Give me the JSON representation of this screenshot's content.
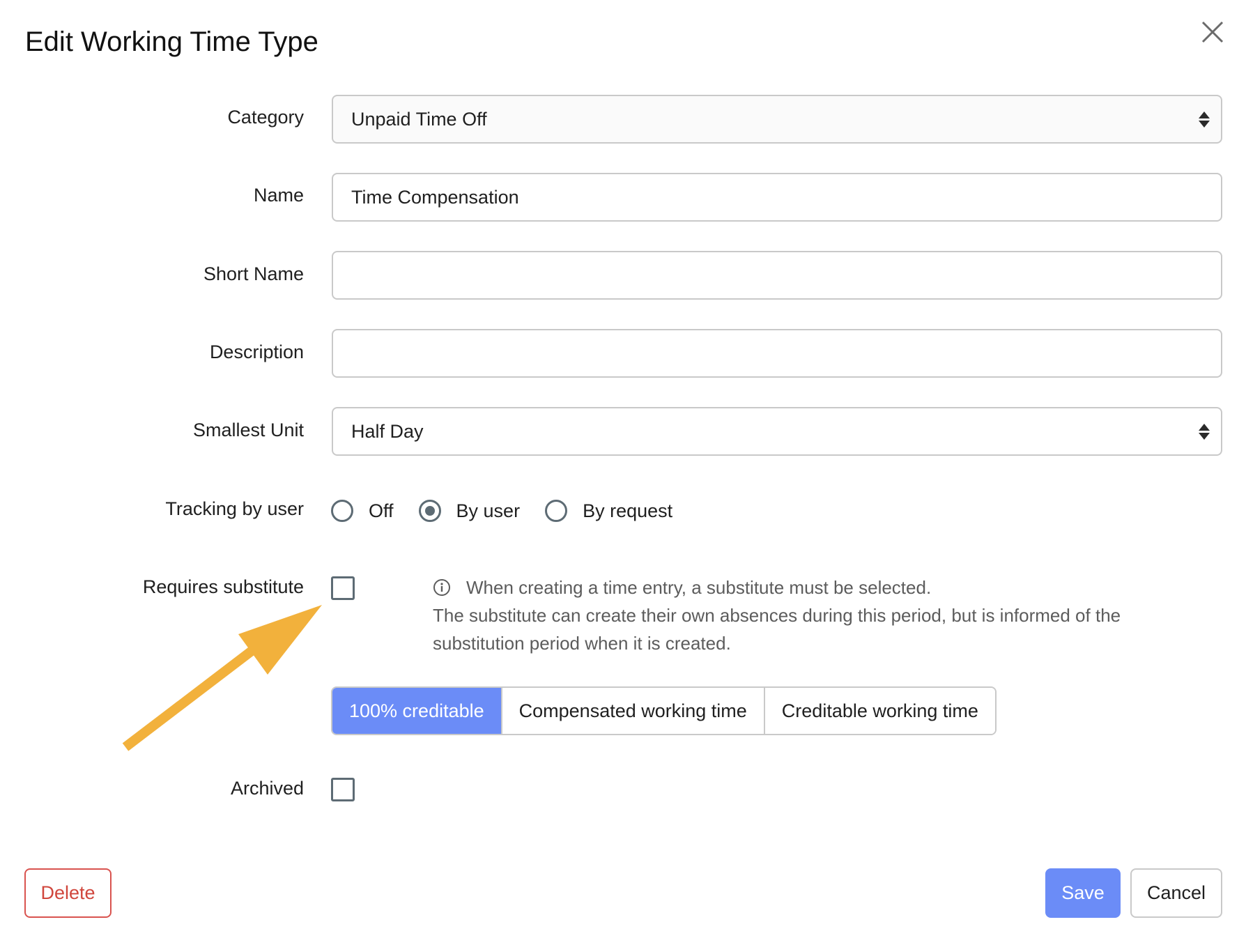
{
  "dialog": {
    "title": "Edit Working Time Type"
  },
  "fields": {
    "category": {
      "label": "Category",
      "value": "Unpaid Time Off"
    },
    "name": {
      "label": "Name",
      "value": "Time Compensation"
    },
    "short_name": {
      "label": "Short Name",
      "value": ""
    },
    "description": {
      "label": "Description",
      "value": ""
    },
    "smallest_unit": {
      "label": "Smallest Unit",
      "value": "Half Day"
    }
  },
  "tracking": {
    "label": "Tracking by user",
    "options": [
      {
        "label": "Off",
        "checked": false
      },
      {
        "label": "By user",
        "checked": true
      },
      {
        "label": "By request",
        "checked": false
      }
    ]
  },
  "requires_substitute": {
    "label": "Requires substitute",
    "checked": false,
    "hint_line1": "When creating a time entry, a substitute must be selected.",
    "hint_rest": "The substitute can create their own absences during this period, but is informed of the substitution period when it is created."
  },
  "credit_mode": {
    "options": [
      {
        "label": "100% creditable",
        "active": true
      },
      {
        "label": "Compensated working time",
        "active": false
      },
      {
        "label": "Creditable working time",
        "active": false
      }
    ]
  },
  "archived": {
    "label": "Archived",
    "checked": false
  },
  "actions": {
    "delete_label": "Delete",
    "save_label": "Save",
    "cancel_label": "Cancel"
  },
  "colors": {
    "accent": "#6b8cf7",
    "danger": "#d0463c",
    "annotation_arrow": "#f2b13c"
  },
  "icons": {
    "close": "close-icon",
    "info": "info-icon",
    "select": "select-arrows-icon"
  }
}
